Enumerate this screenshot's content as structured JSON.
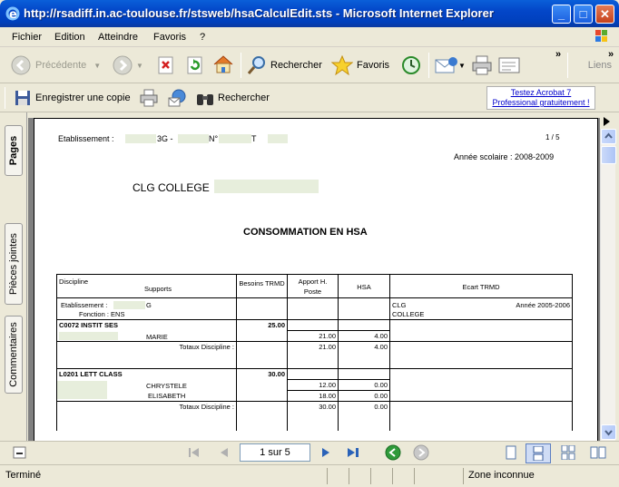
{
  "window": {
    "title": "http://rsadiff.in.ac-toulouse.fr/stsweb/hsaCalculEdit.sts - Microsoft Internet Explorer"
  },
  "menu": [
    "Fichier",
    "Edition",
    "Atteindre",
    "Favoris",
    "?"
  ],
  "toolbar": {
    "back": "Précédente",
    "search": "Rechercher",
    "favorites": "Favoris",
    "links": "Liens"
  },
  "acrobat_toolbar": {
    "save_copy": "Enregistrer une copie",
    "search": "Rechercher",
    "ad": "Testez Acrobat 7 Professional gratuitement !"
  },
  "nav_tabs": [
    "Pages",
    "Pièces jointes",
    "Commentaires"
  ],
  "document": {
    "etab_label": "Etablissement :",
    "etab_visible_1": "3G -",
    "etab_visible_2": "N°",
    "etab_visible_3": "T",
    "page_count": "1 / 5",
    "school_year": "Année scolaire :  2008-2009",
    "college": "CLG COLLEGE",
    "heading": "CONSOMMATION EN HSA",
    "table": {
      "headers": {
        "discipline": "Discipline",
        "supports": "Supports",
        "besoins": "Besoins TRMD",
        "apport": "Apport H. Poste",
        "hsa": "HSA",
        "ecart": "Ecart TRMD"
      },
      "etab_row": {
        "label": "Etablissement :",
        "suffix": "G",
        "fonction_label": "Fonction :",
        "fonction_value": "ENS",
        "ecart_left_1": "CLG",
        "ecart_left_2": "COLLEGE",
        "ecart_right": "Année 2005-2006"
      },
      "groups": [
        {
          "discipline": "C0072 INSTIT SES",
          "besoins": "25.00",
          "people": [
            {
              "name": "MARIE",
              "apport": "21.00",
              "hsa": "4.00"
            }
          ],
          "total_label": "Totaux Discipline :",
          "total_apport": "21.00",
          "total_hsa": "4.00"
        },
        {
          "discipline": "L0201 LETT CLASS",
          "besoins": "30.00",
          "people": [
            {
              "name": "CHRYSTELE",
              "apport": "12.00",
              "hsa": "0.00"
            },
            {
              "name": "ELISABETH",
              "apport": "18.00",
              "hsa": "0.00"
            }
          ],
          "total_label": "Totaux Discipline :",
          "total_apport": "30.00",
          "total_hsa": "0.00"
        }
      ]
    }
  },
  "navbar": {
    "page_field": "1 sur 5"
  },
  "status": {
    "left": "Terminé",
    "zone": "Zone inconnue"
  }
}
